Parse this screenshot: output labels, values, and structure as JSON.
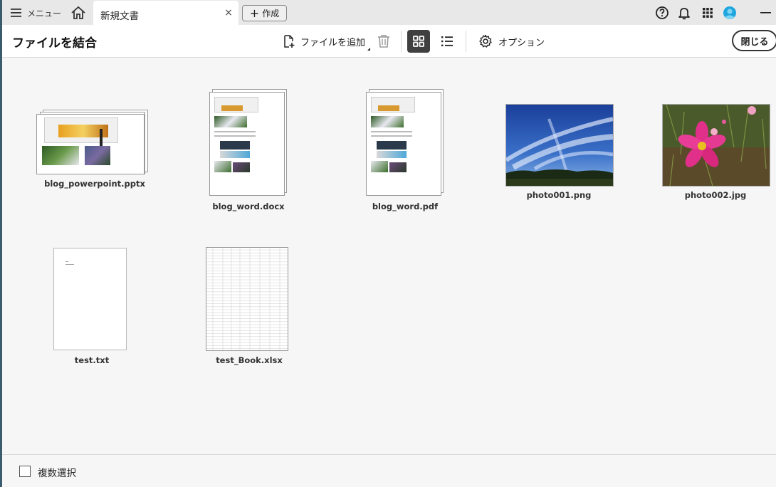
{
  "tabbar": {
    "menu_label": "メニュー",
    "tab_title": "新規文書",
    "tab_close": "×",
    "new_label": "作成"
  },
  "toolbar": {
    "title": "ファイルを結合",
    "add_file_label": "ファイルを追加",
    "options_label": "オプション",
    "close_label": "閉じる"
  },
  "files": [
    {
      "name": "blog_powerpoint.pptx",
      "kind": "pptx"
    },
    {
      "name": "blog_word.docx",
      "kind": "docx"
    },
    {
      "name": "blog_word.pdf",
      "kind": "pdf"
    },
    {
      "name": "photo001.png",
      "kind": "image-sky"
    },
    {
      "name": "photo002.jpg",
      "kind": "image-flower"
    },
    {
      "name": "test.txt",
      "kind": "txt"
    },
    {
      "name": "test_Book.xlsx",
      "kind": "xlsx"
    }
  ],
  "footer": {
    "multi_select_label": "複数選択"
  },
  "colors": {
    "accent_avatar": "#1ea6df",
    "grid_active": "#404040"
  }
}
